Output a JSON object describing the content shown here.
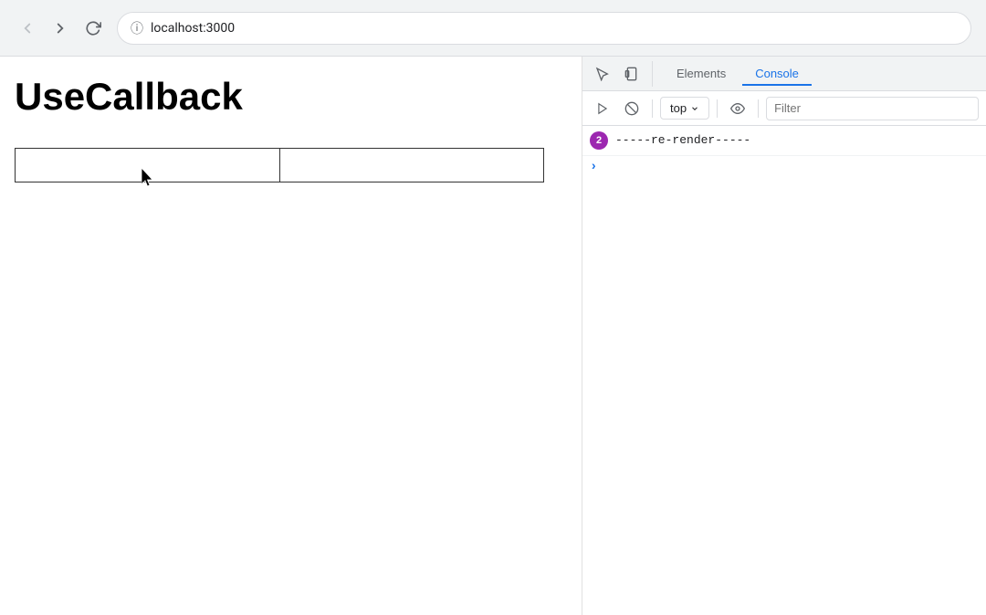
{
  "browser": {
    "url": "localhost:3000",
    "back_btn": "←",
    "forward_btn": "→",
    "reload_btn": "↺"
  },
  "page": {
    "title": "UseCallback",
    "input1_placeholder": "",
    "input2_placeholder": ""
  },
  "devtools": {
    "tab_elements": "Elements",
    "tab_console": "Console",
    "top_label": "top",
    "filter_placeholder": "Filter",
    "message_count": "2",
    "message_text": "-----re-render-----"
  }
}
